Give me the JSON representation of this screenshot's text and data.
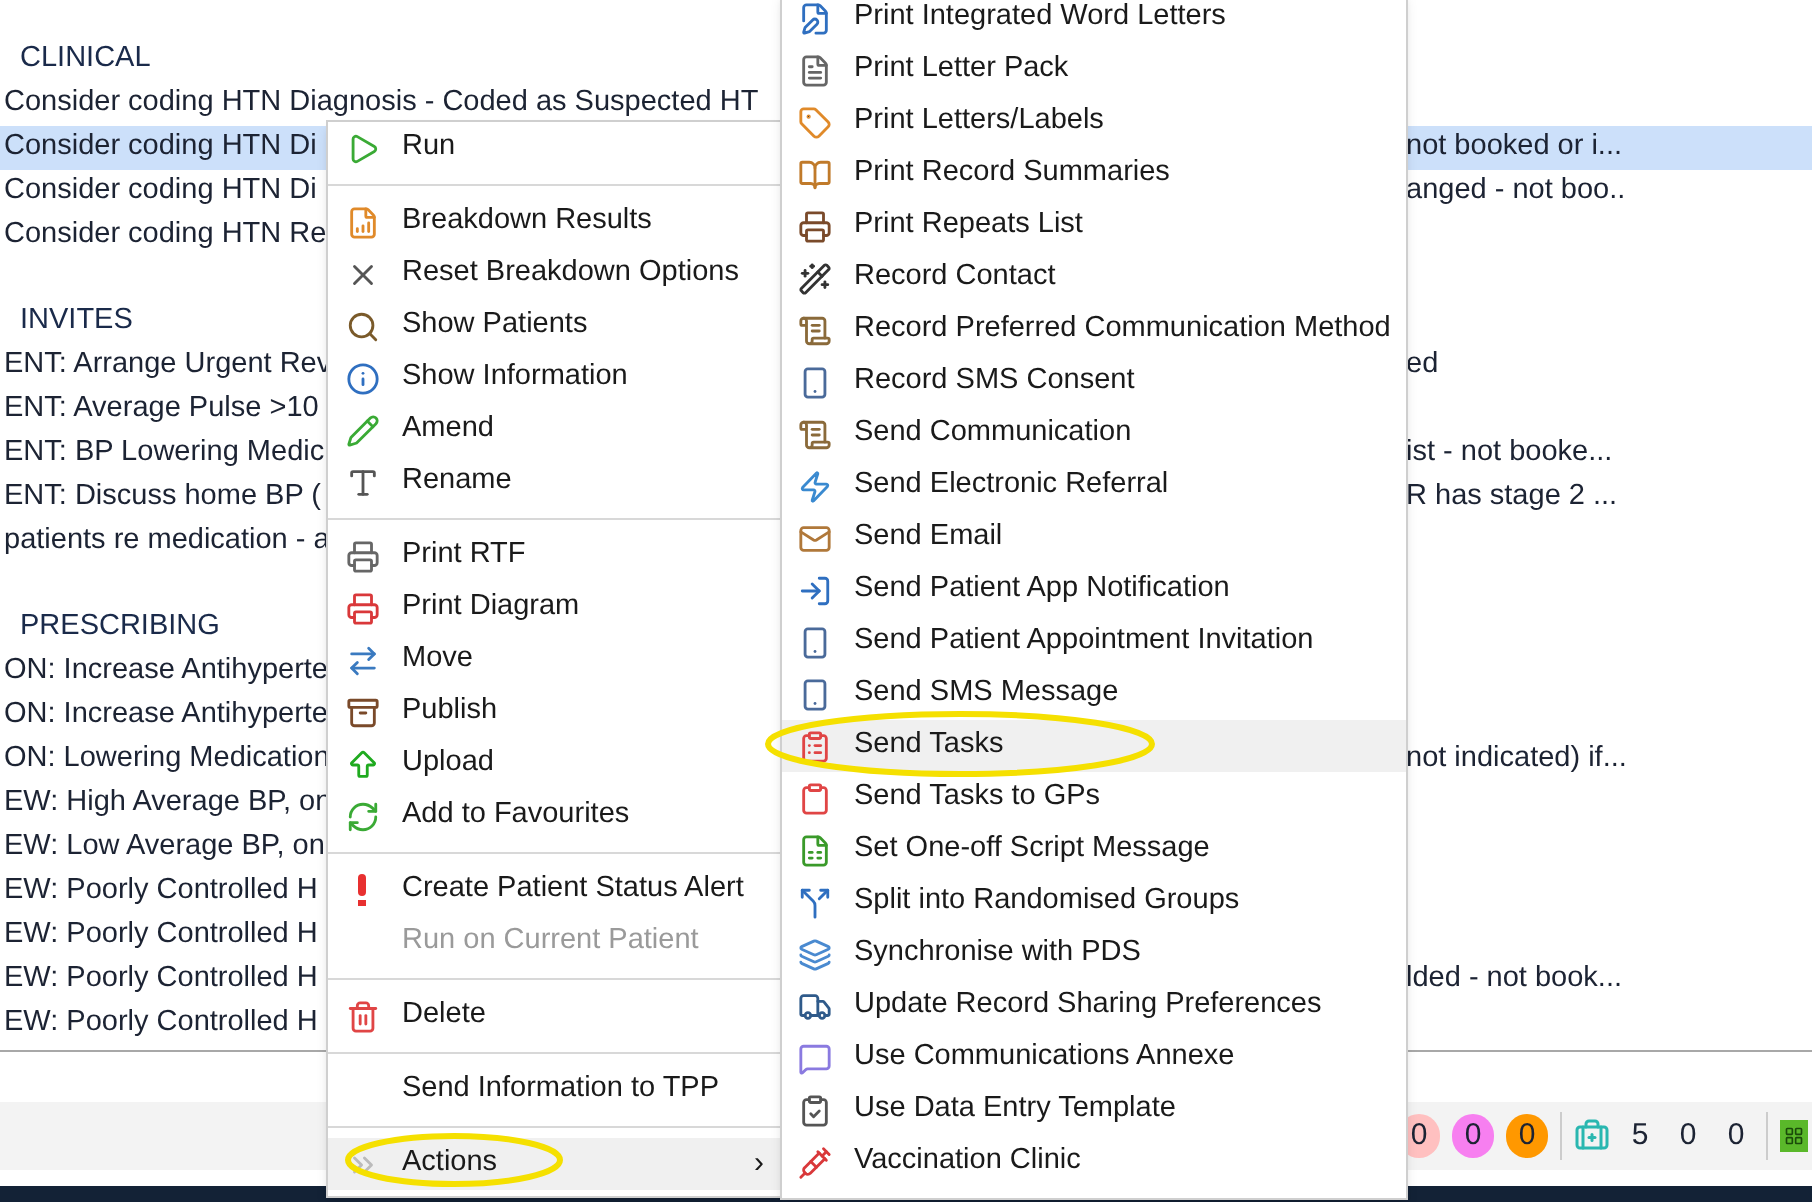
{
  "list": [
    {
      "kind": "header",
      "text": "CLINICAL",
      "selected": false
    },
    {
      "kind": "row",
      "text": "Consider coding HTN Diagnosis - Coded as Suspected HT",
      "selected": false
    },
    {
      "kind": "row",
      "text": "Consider coding HTN Di",
      "tail": "not booked or i...",
      "selected": true
    },
    {
      "kind": "row",
      "text": "Consider coding HTN Di",
      "tail": "anged - not boo..",
      "selected": false
    },
    {
      "kind": "row",
      "text": "Consider coding HTN Re",
      "selected": false
    },
    {
      "kind": "gap"
    },
    {
      "kind": "header",
      "text": "INVITES",
      "selected": false
    },
    {
      "kind": "row",
      "text": "ENT: Arrange Urgent Rev",
      "tail": "ed",
      "selected": false
    },
    {
      "kind": "row",
      "text": "ENT: Average Pulse >10",
      "selected": false
    },
    {
      "kind": "row",
      "text": "ENT: BP Lowering Medic",
      "tail": "ist - not booke...",
      "selected": false
    },
    {
      "kind": "row",
      "text": "ENT: Discuss home BP (",
      "tail": "R has stage 2 ...",
      "selected": false
    },
    {
      "kind": "row",
      "text": "patients re medication - a",
      "selected": false
    },
    {
      "kind": "gap"
    },
    {
      "kind": "header",
      "text": "PRESCRIBING",
      "selected": false
    },
    {
      "kind": "row",
      "text": "ON: Increase Antihyperte",
      "selected": false
    },
    {
      "kind": "row",
      "text": "ON: Increase Antihyperte",
      "selected": false
    },
    {
      "kind": "row",
      "text": "ON: Lowering Medication",
      "tail": "not indicated) if...",
      "selected": false
    },
    {
      "kind": "row",
      "text": "EW: High Average BP, on",
      "selected": false
    },
    {
      "kind": "row",
      "text": "EW: Low Average BP, on",
      "selected": false
    },
    {
      "kind": "row",
      "text": "EW: Poorly Controlled H",
      "selected": false
    },
    {
      "kind": "row",
      "text": "EW: Poorly Controlled H",
      "selected": false
    },
    {
      "kind": "row",
      "text": "EW: Poorly Controlled H",
      "tail": "lded - not book...",
      "selected": false
    },
    {
      "kind": "row",
      "text": "EW: Poorly Controlled H",
      "selected": false
    }
  ],
  "status_bar": {
    "badges": [
      {
        "text": "0",
        "color": "#ffc0c0"
      },
      {
        "text": "0",
        "color": "#f77ff0"
      },
      {
        "text": "0",
        "color": "#ff9800"
      }
    ],
    "counts": [
      "5",
      "0",
      "0"
    ]
  },
  "context_menu": [
    {
      "kind": "item",
      "label": "Run",
      "disabled": false,
      "selected": false
    },
    {
      "kind": "separator"
    },
    {
      "kind": "item",
      "label": "Breakdown Results",
      "disabled": false,
      "selected": false
    },
    {
      "kind": "item",
      "label": "Reset Breakdown Options",
      "disabled": false,
      "selected": false
    },
    {
      "kind": "item",
      "label": "Show Patients",
      "disabled": false,
      "selected": false
    },
    {
      "kind": "item",
      "label": "Show Information",
      "disabled": false,
      "selected": false
    },
    {
      "kind": "item",
      "label": "Amend",
      "disabled": false,
      "selected": false
    },
    {
      "kind": "item",
      "label": "Rename",
      "disabled": false,
      "selected": false
    },
    {
      "kind": "separator"
    },
    {
      "kind": "item",
      "label": "Print RTF",
      "disabled": false,
      "selected": false
    },
    {
      "kind": "item",
      "label": "Print Diagram",
      "disabled": false,
      "selected": false
    },
    {
      "kind": "item",
      "label": "Move",
      "disabled": false,
      "selected": false
    },
    {
      "kind": "item",
      "label": "Publish",
      "disabled": false,
      "selected": false
    },
    {
      "kind": "item",
      "label": "Upload",
      "disabled": false,
      "selected": false
    },
    {
      "kind": "item",
      "label": "Add to Favourites",
      "disabled": false,
      "selected": false
    },
    {
      "kind": "separator"
    },
    {
      "kind": "item",
      "label": "Create Patient Status Alert",
      "disabled": false,
      "selected": false
    },
    {
      "kind": "item",
      "label": "Run on Current Patient",
      "disabled": true,
      "selected": false
    },
    {
      "kind": "separator"
    },
    {
      "kind": "item",
      "label": "Delete",
      "disabled": false,
      "selected": false
    },
    {
      "kind": "separator"
    },
    {
      "kind": "item",
      "label": "Send Information to TPP",
      "disabled": false,
      "selected": false
    },
    {
      "kind": "separator"
    },
    {
      "kind": "item",
      "label": "Actions",
      "arrow": "›",
      "disabled": false,
      "selected": true
    }
  ],
  "actions_submenu": [
    {
      "label": "Print Integrated Word Letters",
      "selected": false
    },
    {
      "label": "Print Letter Pack",
      "selected": false
    },
    {
      "label": "Print Letters/Labels",
      "selected": false
    },
    {
      "label": "Print Record Summaries",
      "selected": false
    },
    {
      "label": "Print Repeats List",
      "selected": false
    },
    {
      "label": "Record Contact",
      "selected": false
    },
    {
      "label": "Record Preferred Communication Method",
      "selected": false
    },
    {
      "label": "Record SMS Consent",
      "selected": false
    },
    {
      "label": "Send Communication",
      "selected": false
    },
    {
      "label": "Send Electronic Referral",
      "selected": false
    },
    {
      "label": "Send Email",
      "selected": false
    },
    {
      "label": "Send Patient App Notification",
      "selected": false
    },
    {
      "label": "Send Patient Appointment Invitation",
      "selected": false
    },
    {
      "label": "Send SMS Message",
      "selected": false
    },
    {
      "label": "Send Tasks",
      "selected": true
    },
    {
      "label": "Send Tasks to GPs",
      "selected": false
    },
    {
      "label": "Set One-off Script Message",
      "selected": false
    },
    {
      "label": "Split into Randomised Groups",
      "selected": false
    },
    {
      "label": "Synchronise with PDS",
      "selected": false
    },
    {
      "label": "Update Record Sharing Preferences",
      "selected": false
    },
    {
      "label": "Use Communications Annexe",
      "selected": false
    },
    {
      "label": "Use Data Entry Template",
      "selected": false
    },
    {
      "label": "Vaccination Clinic",
      "selected": false
    }
  ]
}
